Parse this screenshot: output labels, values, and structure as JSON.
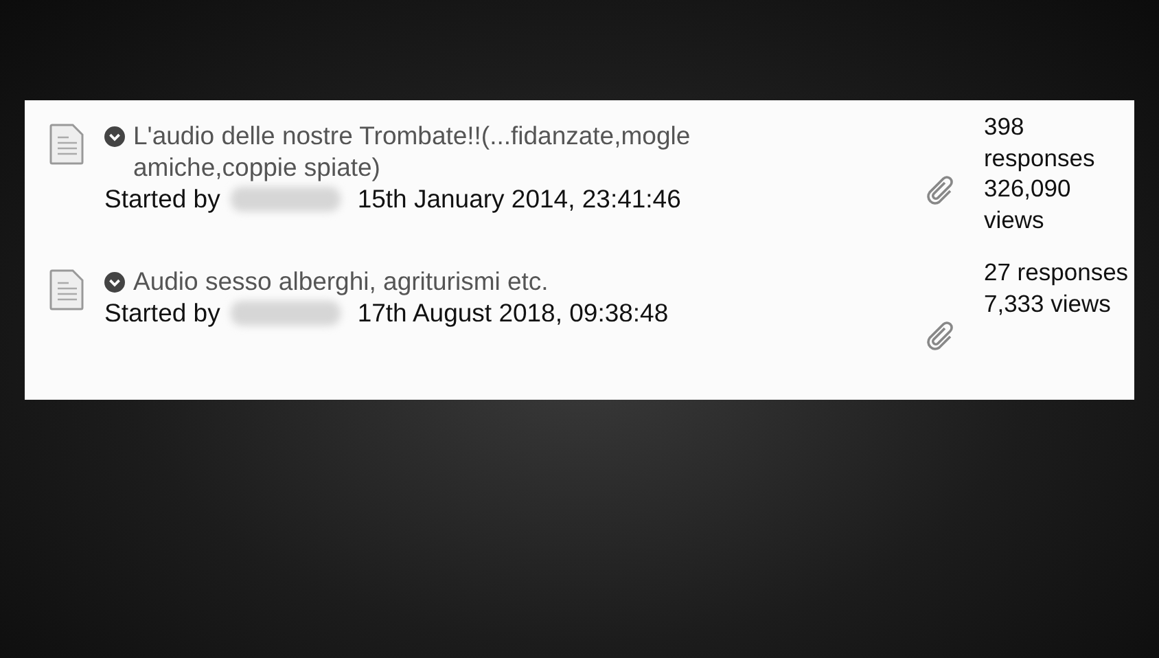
{
  "threads": [
    {
      "title": "L'audio delle nostre Trombate!!(...fidanzate,mogle amiche,coppie spiate)",
      "started_by": "Started by",
      "date": "15th January 2014, 23:41:46",
      "responses": "398 responses",
      "views": "326,090 views"
    },
    {
      "title": "Audio sesso alberghi, agriturismi etc.",
      "started_by": "Started by",
      "date": "17th August 2018, 09:38:48",
      "responses": "27 responses",
      "views": "7,333 views"
    }
  ]
}
